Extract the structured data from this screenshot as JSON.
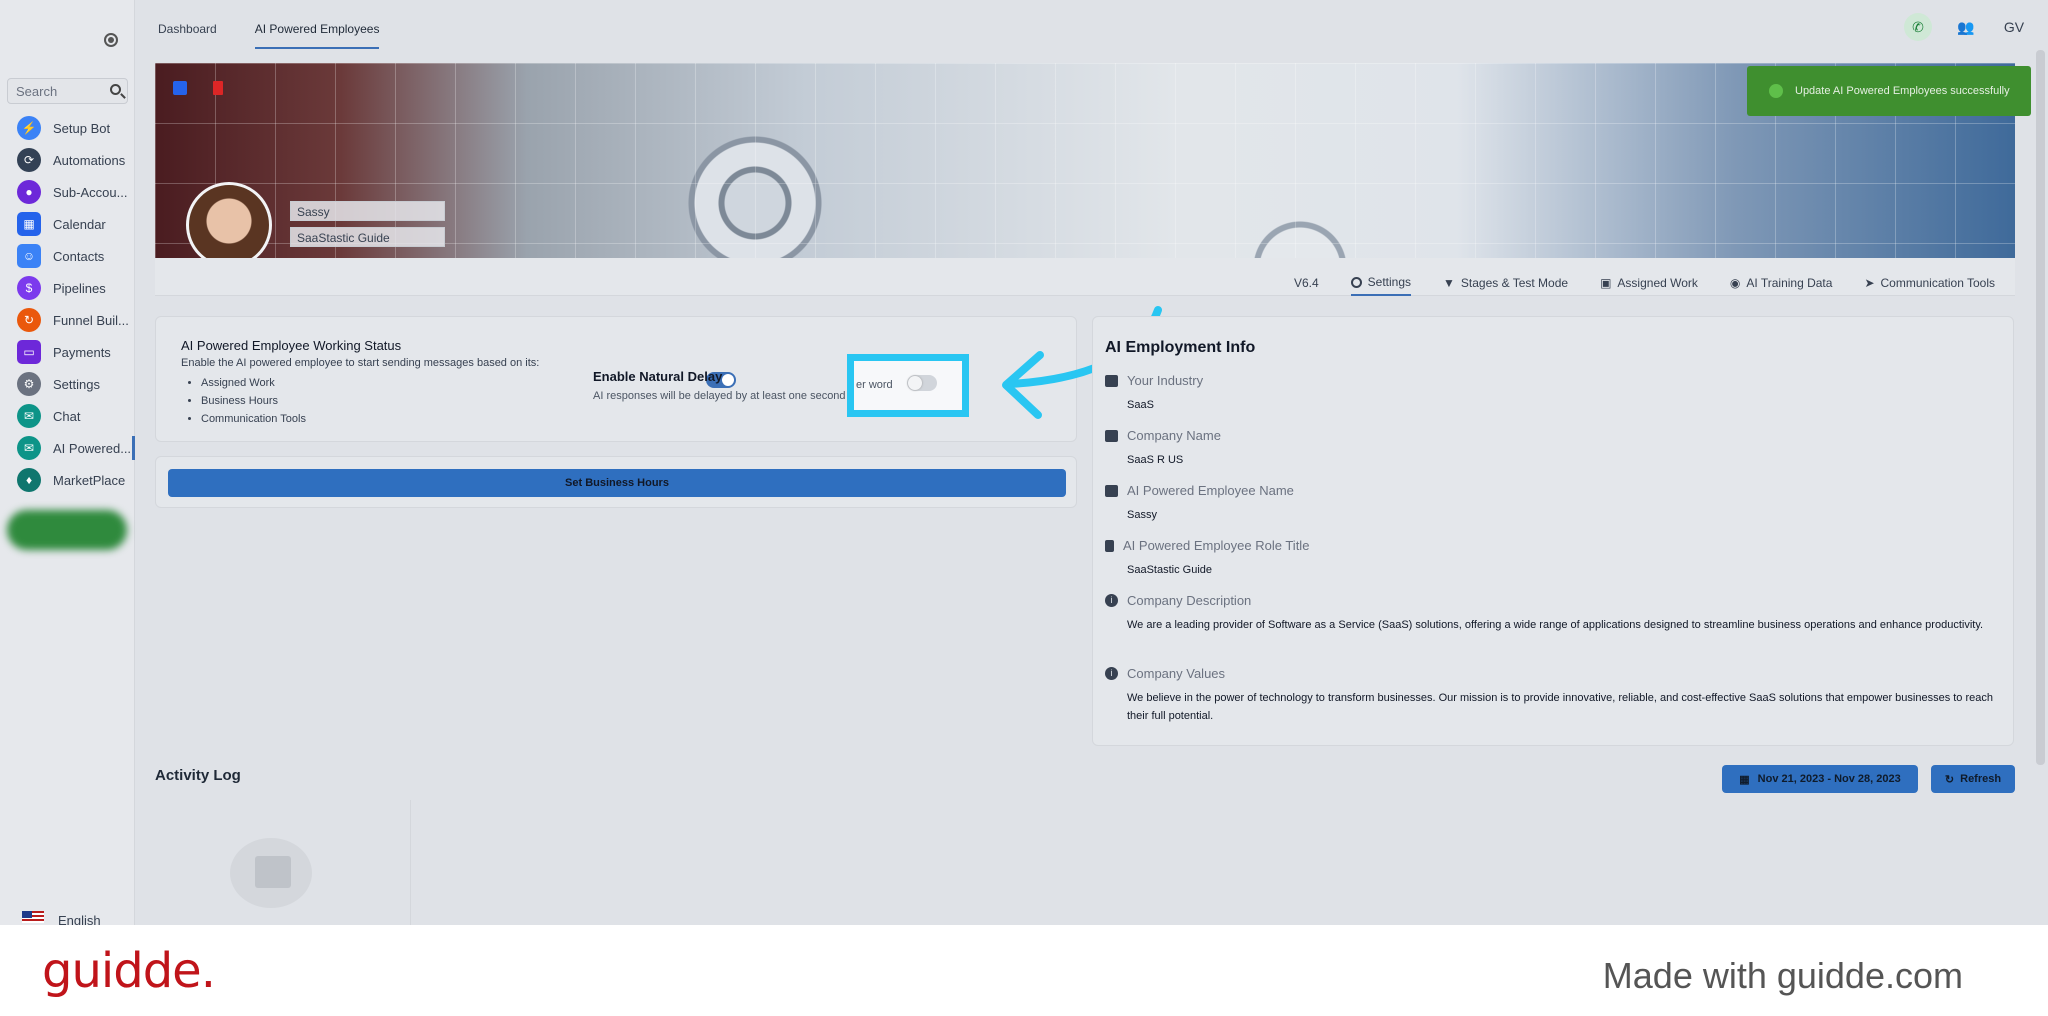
{
  "sidebar": {
    "search_placeholder": "Search",
    "items": [
      {
        "label": "Setup Bot",
        "icon": "bolt-icon",
        "color": "#3b82f6"
      },
      {
        "label": "Automations",
        "icon": "automation-icon",
        "color": "#334155"
      },
      {
        "label": "Sub-Accou...",
        "icon": "user-icon",
        "color": "#6d28d9"
      },
      {
        "label": "Calendar",
        "icon": "calendar-icon",
        "color": "#2563eb"
      },
      {
        "label": "Contacts",
        "icon": "contact-icon",
        "color": "#3b82f6"
      },
      {
        "label": "Pipelines",
        "icon": "dollar-icon",
        "color": "#7c3aed"
      },
      {
        "label": "Funnel Buil...",
        "icon": "funnel-icon",
        "color": "#ea580c"
      },
      {
        "label": "Payments",
        "icon": "card-icon",
        "color": "#6d28d9"
      },
      {
        "label": "Settings",
        "icon": "gear-icon",
        "color": "#6b7280"
      },
      {
        "label": "Chat",
        "icon": "chat-icon",
        "color": "#0d9488"
      },
      {
        "label": "AI Powered...",
        "icon": "ai-chat-icon",
        "color": "#0d9488"
      },
      {
        "label": "MarketPlace",
        "icon": "marketplace-icon",
        "color": "#0f766e"
      }
    ],
    "language": "English"
  },
  "topnav": {
    "dashboard": "Dashboard",
    "ai_employees": "AI Powered Employees",
    "avatar_initials": "GV"
  },
  "profile": {
    "name": "Sassy",
    "role": "SaaStastic Guide"
  },
  "tabs": {
    "version": "V6.4",
    "settings": "Settings",
    "stages": "Stages & Test Mode",
    "assigned": "Assigned Work",
    "training": "AI Training Data",
    "comm": "Communication Tools"
  },
  "status": {
    "title": "AI Powered Employee Working Status",
    "desc": "Enable the AI powered employee to start sending messages based on its:",
    "bullets": [
      "Assigned Work",
      "Business Hours",
      "Communication Tools"
    ],
    "delay_title": "Enable Natural Delay",
    "delay_desc": "AI responses will be delayed by at least one second",
    "delay_desc_tail": "er word"
  },
  "hours": {
    "button": "Set Business Hours"
  },
  "info": {
    "title": "AI Employment Info",
    "industry_label": "Your Industry",
    "industry": "SaaS",
    "company_label": "Company Name",
    "company": "SaaS R US",
    "employee_label": "AI Powered Employee Name",
    "employee": "Sassy",
    "role_label": "AI Powered Employee Role Title",
    "role": "SaaStastic Guide",
    "desc_label": "Company Description",
    "desc": "We are a leading provider of Software as a Service (SaaS) solutions, offering a wide range of applications designed to streamline business operations and enhance productivity.",
    "values_label": "Company Values",
    "values": "We believe in the power of technology to transform businesses. Our mission is to provide innovative, reliable, and cost-effective SaaS solutions that empower businesses to reach their full potential."
  },
  "activity": {
    "title": "Activity Log",
    "date_range": "Nov 21, 2023 - Nov 28, 2023",
    "refresh": "Refresh"
  },
  "toast": {
    "message": "Update AI Powered Employees successfully"
  },
  "footer": {
    "logo": "guidde.",
    "made_with": "Made with guidde.com"
  }
}
